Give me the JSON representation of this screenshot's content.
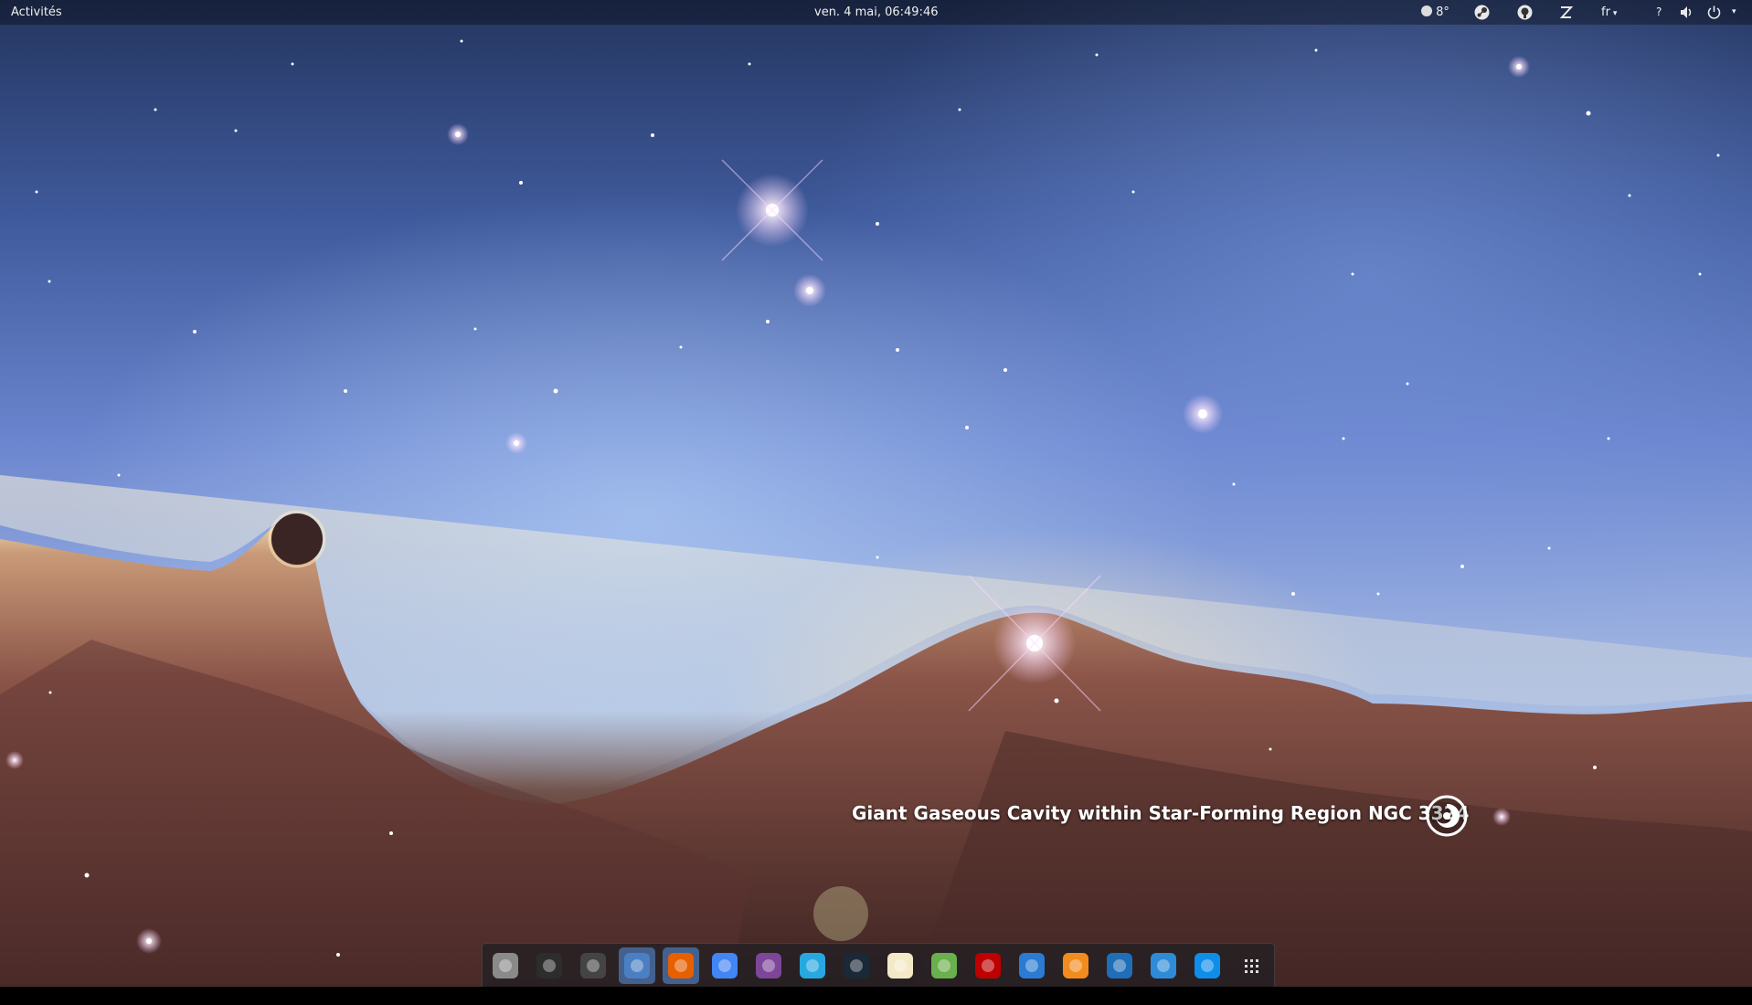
{
  "topbar": {
    "activities_label": "Activités",
    "clock": "ven.  4 mai, 06:49:46",
    "weather": "8°",
    "keyboard_layout": "fr",
    "tray_icons": [
      "weather-icon",
      "steam-icon",
      "github-icon",
      "z-app-icon",
      "keyboard-layout-menu",
      "help-icon",
      "volume-icon",
      "power-icon"
    ]
  },
  "wallpaper": {
    "caption": "Giant Gaseous Cavity within Star-Forming Region NGC 3324",
    "logo": "hubble-spiral-icon"
  },
  "dock": {
    "items": [
      {
        "name": "files-icon",
        "color": "#8a8a8a"
      },
      {
        "name": "terminal-icon",
        "color": "#2d2d2d"
      },
      {
        "name": "photo-app-icon",
        "color": "#444"
      },
      {
        "name": "thunderbird-icon",
        "color": "#4a7fc4",
        "active": true
      },
      {
        "name": "firefox-icon",
        "color": "#e66000",
        "active": true
      },
      {
        "name": "chrome-icon",
        "color": "#4285f4"
      },
      {
        "name": "tor-browser-icon",
        "color": "#7d4698"
      },
      {
        "name": "vscode-icon",
        "color": "#27a8e0"
      },
      {
        "name": "steam-icon",
        "color": "#1b2838"
      },
      {
        "name": "text-editor-icon",
        "color": "#f3e9c6"
      },
      {
        "name": "scissors-app-icon",
        "color": "#6ab04c"
      },
      {
        "name": "filezilla-icon",
        "color": "#bf0000"
      },
      {
        "name": "system-monitor-icon",
        "color": "#2a7bd1"
      },
      {
        "name": "p-app-icon",
        "color": "#f28c1e"
      },
      {
        "name": "gear-app-icon",
        "color": "#1f6eb8"
      },
      {
        "name": "diamond-app-icon",
        "color": "#2e8bd8"
      },
      {
        "name": "teamviewer-icon",
        "color": "#0e8ee9"
      },
      {
        "name": "show-applications-icon",
        "color": "#ddd"
      }
    ]
  }
}
